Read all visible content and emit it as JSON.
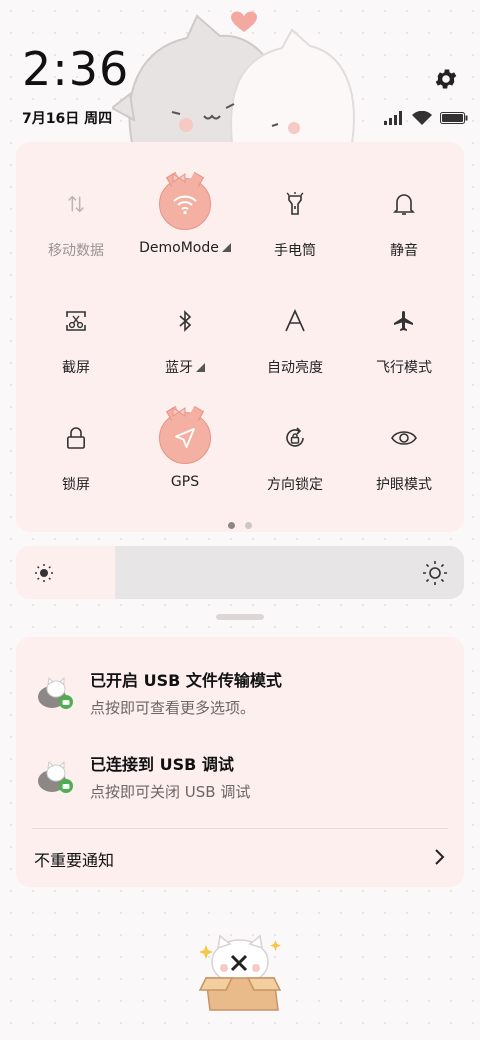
{
  "status_bar": {
    "time": "2:36",
    "date": "7月16日 周四"
  },
  "quick_settings": {
    "tiles": [
      {
        "label": "移动数据",
        "icon": "mobile-data-icon",
        "active": false,
        "dim": true
      },
      {
        "label": "DemoMode",
        "icon": "wifi-icon",
        "active": true,
        "expandable": true
      },
      {
        "label": "手电筒",
        "icon": "flashlight-icon",
        "active": false
      },
      {
        "label": "静音",
        "icon": "bell-icon",
        "active": false
      },
      {
        "label": "截屏",
        "icon": "screenshot-icon",
        "active": false
      },
      {
        "label": "蓝牙",
        "icon": "bluetooth-icon",
        "active": false,
        "expandable": true
      },
      {
        "label": "自动亮度",
        "icon": "auto-brightness-icon",
        "active": false
      },
      {
        "label": "飞行模式",
        "icon": "airplane-icon",
        "active": false
      },
      {
        "label": "锁屏",
        "icon": "lock-icon",
        "active": false
      },
      {
        "label": "GPS",
        "icon": "location-arrow-icon",
        "active": true
      },
      {
        "label": "方向锁定",
        "icon": "rotation-lock-icon",
        "active": false
      },
      {
        "label": "护眼模式",
        "icon": "eye-icon",
        "active": false
      }
    ],
    "page": 1,
    "page_count": 2
  },
  "brightness": {
    "level": 0.22
  },
  "notifications": [
    {
      "title": "已开启 USB 文件传输模式",
      "subtitle": "点按即可查看更多选项。",
      "icon": "android-cat-icon"
    },
    {
      "title": "已连接到 USB 调试",
      "subtitle": "点按即可关闭 USB 调试",
      "icon": "android-cat-icon"
    }
  ],
  "unimportant": {
    "label": "不重要通知"
  },
  "colors": {
    "panel": "#fcefee",
    "active_tile": "#f4b1a3",
    "accent_green": "#4caf50"
  }
}
